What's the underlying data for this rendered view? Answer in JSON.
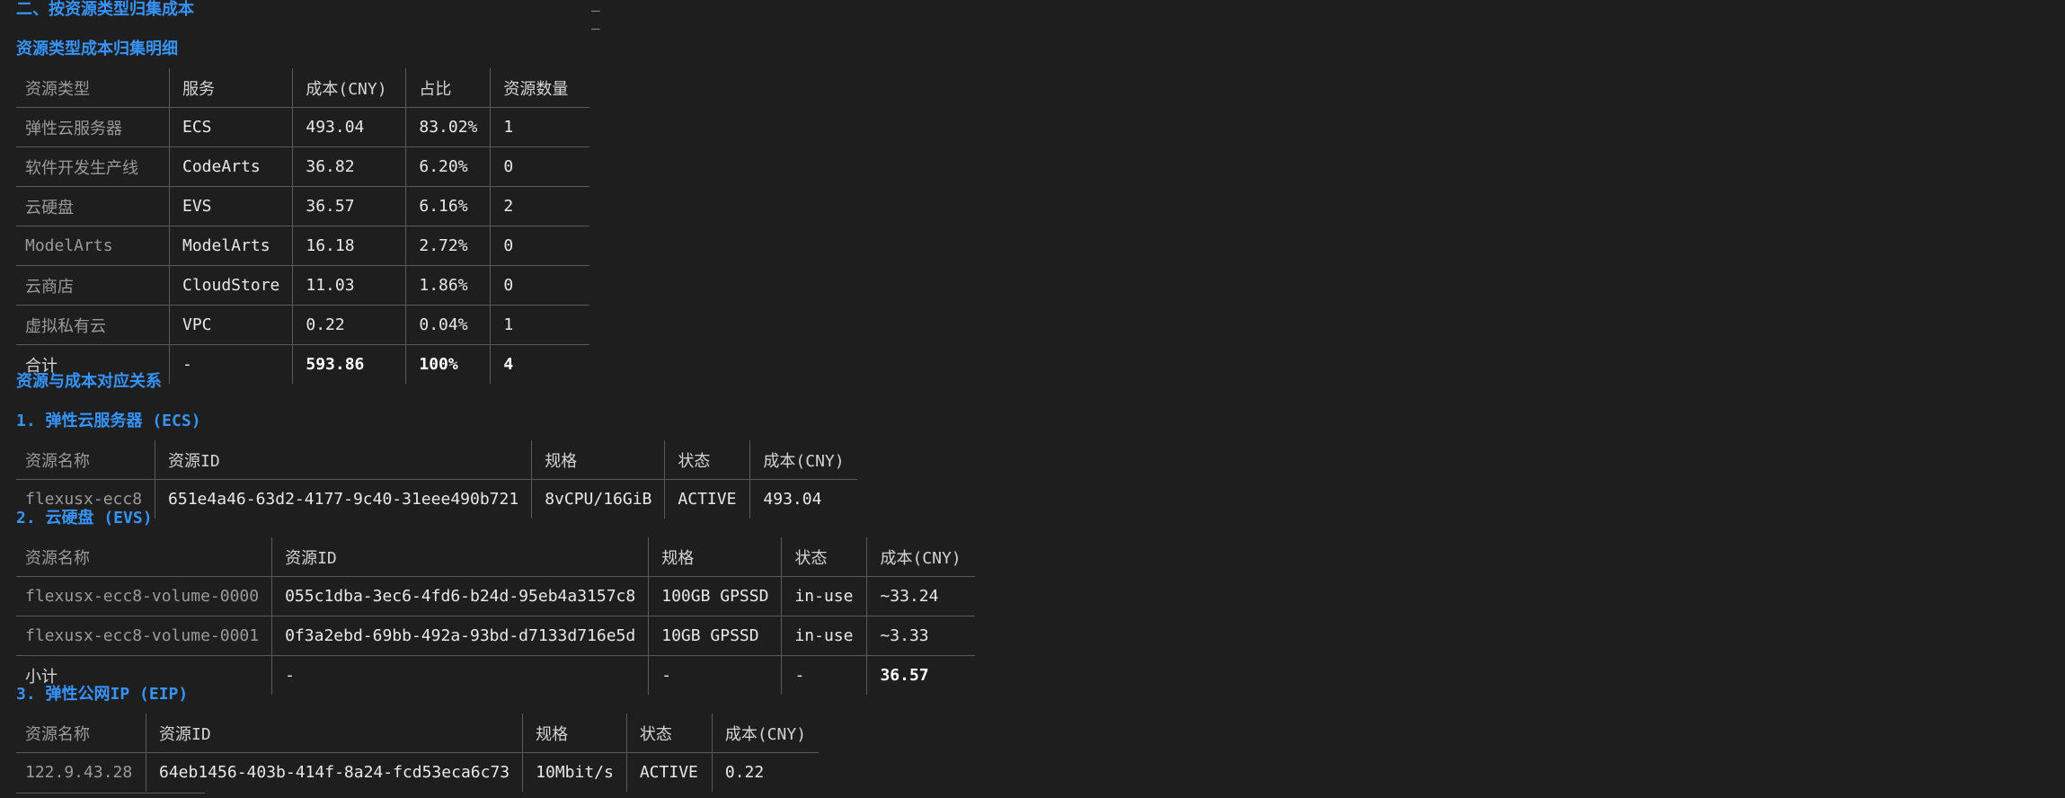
{
  "headings": {
    "section2": "二、按资源类型归集成本",
    "detail": "资源类型成本归集明细",
    "mapping": "资源与成本对应关系",
    "ecs": "1. 弹性云服务器 (ECS)",
    "evs": "2. 云硬盘 (EVS)",
    "eip": "3. 弹性公网IP (EIP)"
  },
  "dashes": [
    "–",
    "–"
  ],
  "type_table": {
    "headers": [
      "资源类型",
      "服务",
      "成本(CNY)",
      "占比",
      "资源数量"
    ],
    "rows": [
      [
        "弹性云服务器",
        "ECS",
        "493.04",
        "83.02%",
        "1"
      ],
      [
        "软件开发生产线",
        "CodeArts",
        "36.82",
        "6.20%",
        "0"
      ],
      [
        "云硬盘",
        "EVS",
        "36.57",
        "6.16%",
        "2"
      ],
      [
        "ModelArts",
        "ModelArts",
        "16.18",
        "2.72%",
        "0"
      ],
      [
        "云商店",
        "CloudStore",
        "11.03",
        "1.86%",
        "0"
      ],
      [
        "虚拟私有云",
        "VPC",
        "0.22",
        "0.04%",
        "1"
      ]
    ],
    "total": [
      "合计",
      "-",
      "593.86",
      "100%",
      "4"
    ]
  },
  "ecs_table": {
    "headers": [
      "资源名称",
      "资源ID",
      "规格",
      "状态",
      "成本(CNY)"
    ],
    "rows": [
      [
        "flexusx-ecc8",
        "651e4a46-63d2-4177-9c40-31eee490b721",
        "8vCPU/16GiB",
        "ACTIVE",
        "493.04"
      ]
    ]
  },
  "evs_table": {
    "headers": [
      "资源名称",
      "资源ID",
      "规格",
      "状态",
      "成本(CNY)"
    ],
    "rows": [
      [
        "flexusx-ecc8-volume-0000",
        "055c1dba-3ec6-4fd6-b24d-95eb4a3157c8",
        "100GB GPSSD",
        "in-use",
        "~33.24"
      ],
      [
        "flexusx-ecc8-volume-0001",
        "0f3a2ebd-69bb-492a-93bd-d7133d716e5d",
        "10GB GPSSD",
        "in-use",
        "~3.33"
      ]
    ],
    "subtotal": [
      "小计",
      "-",
      "-",
      "-",
      "36.57"
    ]
  },
  "eip_table": {
    "headers": [
      "资源名称",
      "资源ID",
      "规格",
      "状态",
      "成本(CNY)"
    ],
    "rows": [
      [
        "122.9.43.28",
        "64eb1456-403b-414f-8a24-fcd53eca6c73",
        "10Mbit/s",
        "ACTIVE",
        "0.22"
      ]
    ]
  }
}
